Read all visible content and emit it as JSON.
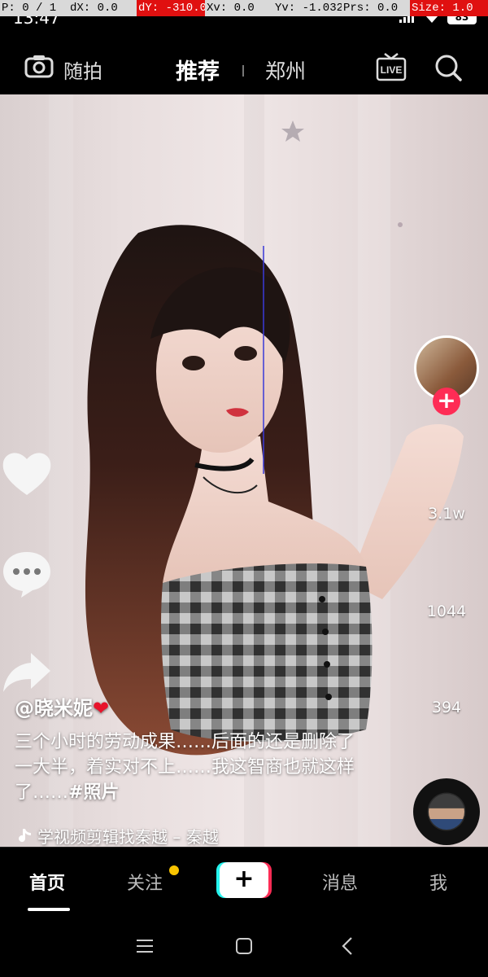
{
  "debug": {
    "p": "P: 0 / 1",
    "dx": "dX: 0.0",
    "dy": "dY: -310.0",
    "xv": "Xv: 0.0",
    "yv": "Yv: -1.032",
    "prs": "Prs: 0.0",
    "size": "Size: 1.0"
  },
  "status_bar": {
    "time": "13:47",
    "battery": "83"
  },
  "top_nav": {
    "camera_label": "随拍",
    "tab_recommend": "推荐",
    "tab_city": "郑州",
    "live_label": "LIVE"
  },
  "video": {
    "likes": "3.1w",
    "comments": "1044",
    "shares": "394"
  },
  "caption": {
    "author": "@晓米妮",
    "heart": "❤",
    "text": "三个小时的劳动成果……后面的还是删除了一大半，着实对不上……我这智商也就这样了……",
    "hashtag": "#照片",
    "music": "学视频剪辑找秦越 – 秦越"
  },
  "bottom_nav": {
    "home": "首页",
    "follow": "关注",
    "plus": "+",
    "messages": "消息",
    "me": "我"
  },
  "colors": {
    "accent_red": "#fe2c55",
    "accent_cyan": "#25f4ee",
    "dot_yellow": "#f9c400"
  }
}
